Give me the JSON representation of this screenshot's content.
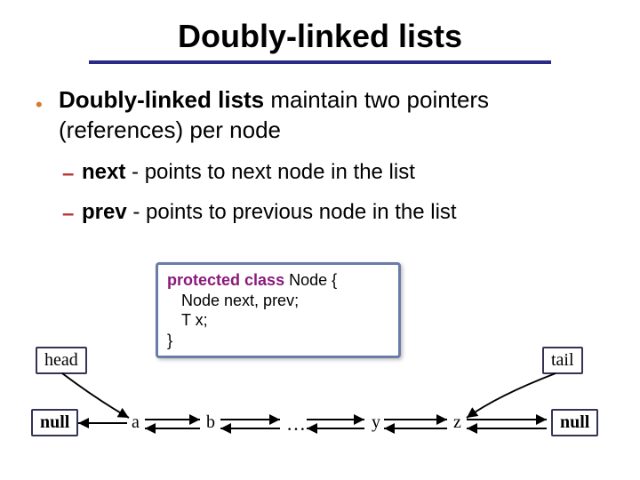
{
  "title": "Doubly-linked lists",
  "bullet1": {
    "lead": "Doubly-linked lists",
    "rest": " maintain two pointers (references) per node"
  },
  "sub": [
    {
      "lead": "next",
      "rest": " - points to next node in the list"
    },
    {
      "lead": "prev",
      "rest": " - points to previous node in the list"
    }
  ],
  "code": {
    "line1_kw1": "protected",
    "line1_kw2": "class",
    "line1_rest": " Node {",
    "line2": "Node next, prev;",
    "line3": "T x;",
    "line4": "}"
  },
  "diagram": {
    "head": "head",
    "tail": "tail",
    "null": "null",
    "nodes": [
      "a",
      "b",
      "…",
      "y",
      "z"
    ]
  }
}
